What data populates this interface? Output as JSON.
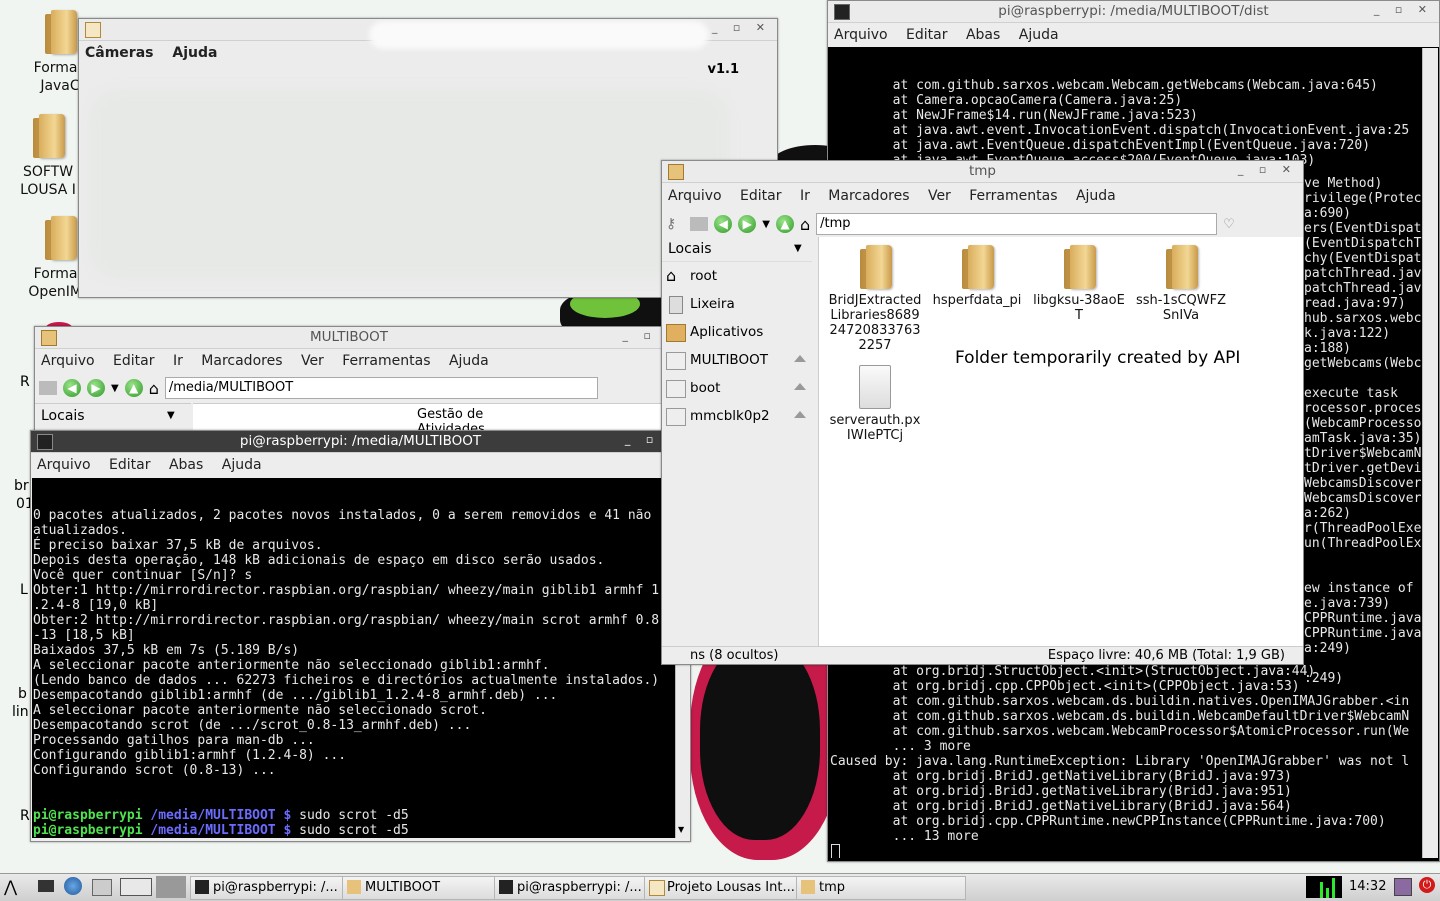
{
  "desktop": {
    "icons": [
      {
        "label_1": "FormaE",
        "label_2": "JavaC"
      },
      {
        "label_1": "SOFTW",
        "label_2": "LOUSA I"
      },
      {
        "label_1": "FormaE",
        "label_2": "OpenIMA"
      }
    ],
    "edge_fragments": [
      "R",
      "br",
      "01",
      "L",
      "b",
      "lin",
      "R"
    ]
  },
  "cameras_window": {
    "menu": [
      "Câmeras",
      "Ajuda"
    ],
    "version": "v1.1"
  },
  "dist_terminal": {
    "title": "pi@raspberrypi: /media/MULTIBOOT/dist",
    "menu": [
      "Arquivo",
      "Editar",
      "Abas",
      "Ajuda"
    ],
    "lines_top": [
      "        at com.github.sarxos.webcam.Webcam.getWebcams(Webcam.java:645)",
      "        at Camera.opcaoCamera(Camera.java:25)",
      "        at NewJFrame$14.run(NewJFrame.java:523)",
      "        at java.awt.event.InvocationEvent.dispatch(InvocationEvent.java:25",
      "        at java.awt.EventQueue.dispatchEventImpl(EventQueue.java:720)",
      "        at java.awt.EventQueue.access$200(EventQueue.java:103)",
      "        at java.awt.EventQueue$3.run(EventQueue.java:681)",
      "        at java.awt.EventQueue$3.run(EventQueue.java:679)"
    ],
    "lines_right": [
      "ve Method)",
      "rivilege(Protec",
      "a:690)",
      "ers(EventDispat",
      "(EventDispatchT",
      "chy(EventDispat",
      "patchThread.jav",
      "patchThread.jav",
      "read.java:97)",
      "hub.sarxos.webc",
      "k.java:122)",
      "a:188)",
      "getWebcams(Webc",
      "",
      "execute task",
      "rocessor.proces",
      "(WebcamProcesso",
      "amTask.java:35)",
      "tDriver$WebcamN",
      "tDriver.getDevi",
      "WebcamsDiscover",
      "WebcamsDiscover",
      "a:262)",
      "r(ThreadPoolExe",
      "un(ThreadPoolEx",
      "",
      "",
      "ew instance of",
      "e.java:739)",
      "CPPRuntime.java",
      "CPPRuntime.java",
      "a:249)",
      "",
      ":249)"
    ],
    "lines_bottom": [
      "        at org.bridj.StructObject.<init>(StructObject.java:44)",
      "        at org.bridj.cpp.CPPObject.<init>(CPPObject.java:53)",
      "        at com.github.sarxos.webcam.ds.buildin.natives.OpenIMAJGrabber.<in",
      "        at com.github.sarxos.webcam.ds.buildin.WebcamDefaultDriver$WebcamN",
      "        at com.github.sarxos.webcam.WebcamProcessor$AtomicProcessor.run(We",
      "        ... 3 more",
      "Caused by: java.lang.RuntimeException: Library 'OpenIMAJGrabber' was not l",
      "        at org.bridj.BridJ.getNativeLibrary(BridJ.java:973)",
      "        at org.bridj.BridJ.getNativeLibrary(BridJ.java:951)",
      "        at org.bridj.BridJ.getNativeLibrary(BridJ.java:564)",
      "        at org.bridj.cpp.CPPRuntime.newCPPInstance(CPPRuntime.java:700)",
      "        ... 13 more"
    ]
  },
  "tmp_window": {
    "title": "tmp",
    "menu": [
      "Arquivo",
      "Editar",
      "Ir",
      "Marcadores",
      "Ver",
      "Ferramentas",
      "Ajuda"
    ],
    "path": "/tmp",
    "sidebar_header": "Locais",
    "places": [
      "root",
      "Lixeira",
      "Aplicativos",
      "MULTIBOOT",
      "boot",
      "mmcblk0p2"
    ],
    "files": [
      {
        "name": "BridJExtracted Libraries8689 24720833763 2257"
      },
      {
        "name": "hsperfdata_pi"
      },
      {
        "name": "libgksu-38aoE T"
      },
      {
        "name": "ssh-1sCQWFZ SnIVa"
      },
      {
        "name": "serverauth.px IWIePTCj"
      }
    ],
    "annotation": "Folder temporarily created by API",
    "status_left": "ns (8 ocultos)",
    "status_right": "Espaço livre: 40,6 MB (Total: 1,9 GB)"
  },
  "multiboot_window": {
    "title": "MULTIBOOT",
    "menu": [
      "Arquivo",
      "Editar",
      "Ir",
      "Marcadores",
      "Ver",
      "Ferramentas",
      "Ajuda"
    ],
    "path": "/media/MULTIBOOT",
    "sidebar_header": "Locais",
    "partial_item": "Gestão de Atividades"
  },
  "main_terminal": {
    "title": "pi@raspberrypi: /media/MULTIBOOT",
    "menu": [
      "Arquivo",
      "Editar",
      "Abas",
      "Ajuda"
    ],
    "lines": [
      "0 pacotes atualizados, 2 pacotes novos instalados, 0 a serem removidos e 41 não",
      "atualizados.",
      "É preciso baixar 37,5 kB de arquivos.",
      "Depois desta operação, 148 kB adicionais de espaço em disco serão usados.",
      "Você quer continuar [S/n]? s",
      "Obter:1 http://mirrordirector.raspbian.org/raspbian/ wheezy/main giblib1 armhf 1",
      ".2.4-8 [19,0 kB]",
      "Obter:2 http://mirrordirector.raspbian.org/raspbian/ wheezy/main scrot armhf 0.8",
      "-13 [18,5 kB]",
      "Baixados 37,5 kB em 7s (5.189 B/s)",
      "A seleccionar pacote anteriormente não seleccionado giblib1:armhf.",
      "(Lendo banco de dados ... 62273 ficheiros e directórios actualmente instalados.)",
      "Desempacotando giblib1:armhf (de .../giblib1_1.2.4-8_armhf.deb) ...",
      "A seleccionar pacote anteriormente não seleccionado scrot.",
      "Desempacotando scrot (de .../scrot_0.8-13_armhf.deb) ...",
      "Processando gatilhos para man-db ...",
      "Configurando giblib1:armhf (1.2.4-8) ...",
      "Configurando scrot (0.8-13) ..."
    ],
    "prompt_user": "pi@raspberrypi",
    "prompt_path": " /media/MULTIBOOT $",
    "command": " sudo scrot -d5"
  },
  "taskbar": {
    "tasks": [
      "pi@raspberrypi: /...",
      "MULTIBOOT",
      "pi@raspberrypi: /...",
      "Projeto Lousas Int...",
      "tmp"
    ],
    "clock": "14:32"
  }
}
